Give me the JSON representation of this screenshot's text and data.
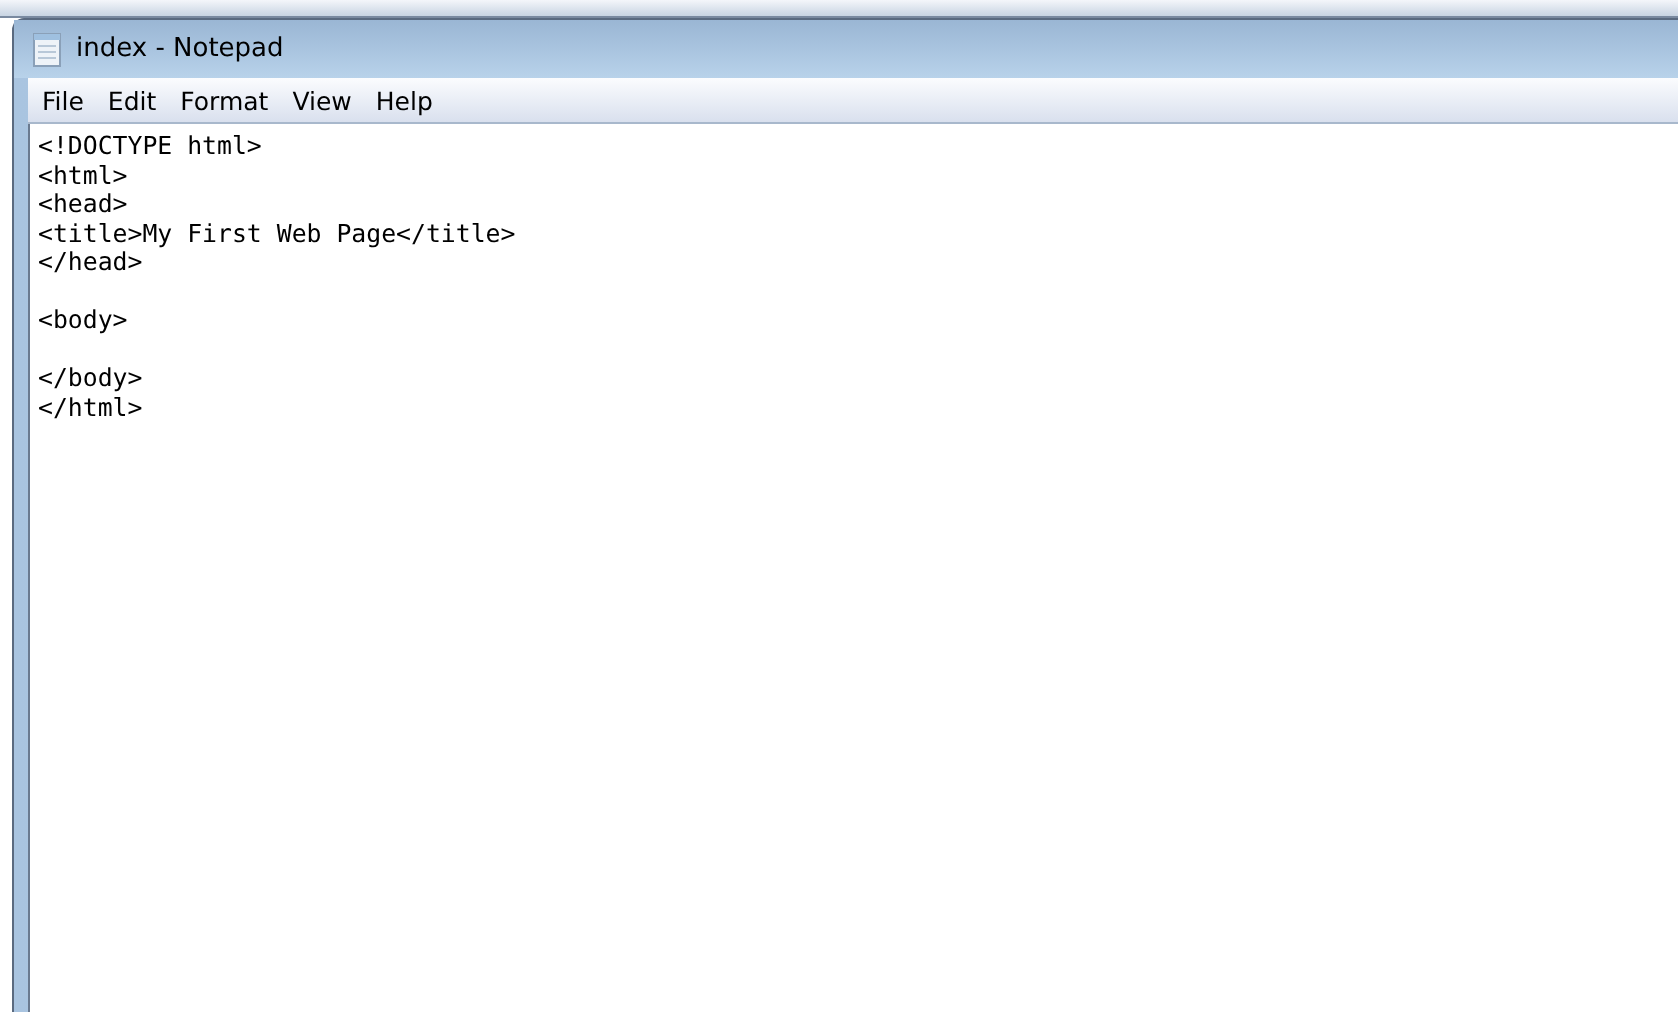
{
  "window": {
    "title": "index - Notepad"
  },
  "menu": [
    "File",
    "Edit",
    "Format",
    "View",
    "Help"
  ],
  "editor": {
    "text": "<!DOCTYPE html>\n<html>\n<head>\n<title>My First Web Page</title>\n</head>\n\n<body>\n\n</body>\n</html>"
  }
}
